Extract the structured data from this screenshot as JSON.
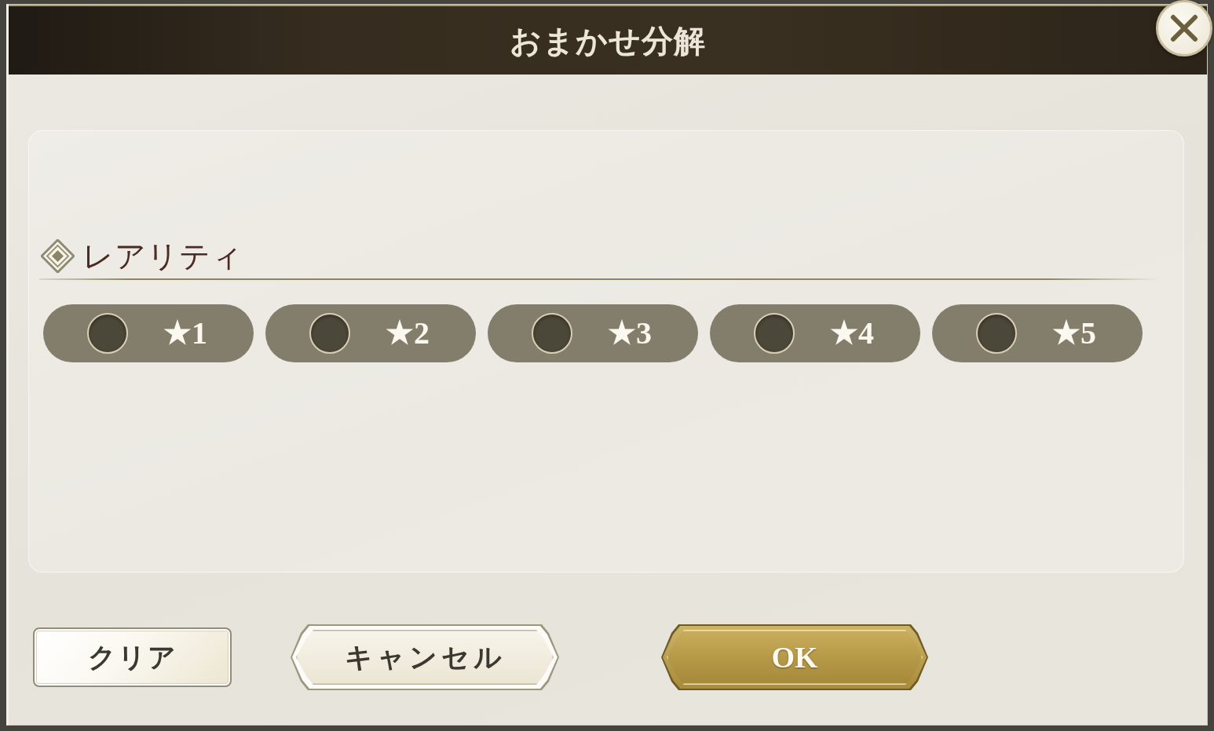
{
  "dialog": {
    "title": "おまかせ分解",
    "section": {
      "heading": "レアリティ",
      "options": [
        {
          "label": "★1",
          "selected": false
        },
        {
          "label": "★2",
          "selected": false
        },
        {
          "label": "★3",
          "selected": false
        },
        {
          "label": "★4",
          "selected": false
        },
        {
          "label": "★5",
          "selected": false
        }
      ]
    },
    "buttons": [
      {
        "label": "クリア",
        "kind": "plain"
      },
      {
        "label": "キャンセル",
        "kind": "secondary"
      },
      {
        "label": "OK",
        "kind": "primary"
      }
    ]
  }
}
